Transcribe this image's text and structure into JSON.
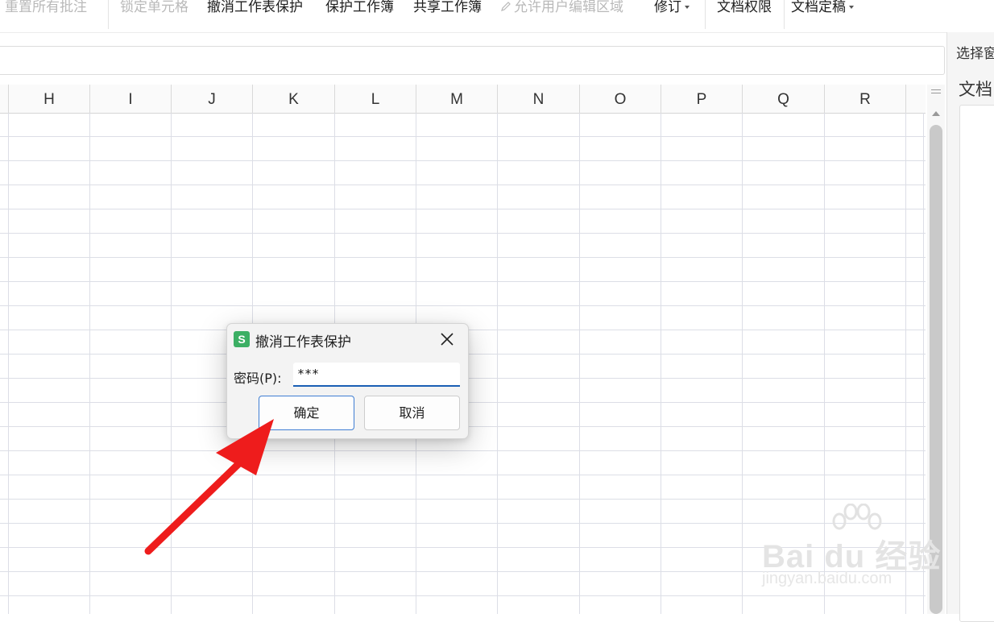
{
  "ribbon": {
    "items": [
      {
        "label": "重置所有批注",
        "enabled": false
      },
      {
        "label": "锁定单元格",
        "enabled": false
      },
      {
        "label": "撤消工作表保护",
        "enabled": true
      },
      {
        "label": "保护工作簿",
        "enabled": true
      },
      {
        "label": "共享工作簿",
        "enabled": true
      },
      {
        "label": "允许用户编辑区域",
        "enabled": false
      },
      {
        "label": "修订",
        "enabled": true
      },
      {
        "label": "文档权限",
        "enabled": true
      },
      {
        "label": "文档定稿",
        "enabled": true
      }
    ]
  },
  "sheet": {
    "columns": [
      "H",
      "I",
      "J",
      "K",
      "L",
      "M",
      "N",
      "O",
      "P",
      "Q",
      "R"
    ]
  },
  "right_pane": {
    "title": "选择窗",
    "subtitle": "文档"
  },
  "dialog": {
    "app_icon_letter": "S",
    "title": "撤消工作表保护",
    "password_label": "密码(P):",
    "password_value": "***",
    "ok_label": "确定",
    "cancel_label": "取消",
    "accent_color": "#3caf64"
  },
  "annotation": {
    "arrow_color": "#ee1c1c"
  },
  "watermark": {
    "brand": "Bai du 经验",
    "url": "jingyan.baidu.com"
  }
}
